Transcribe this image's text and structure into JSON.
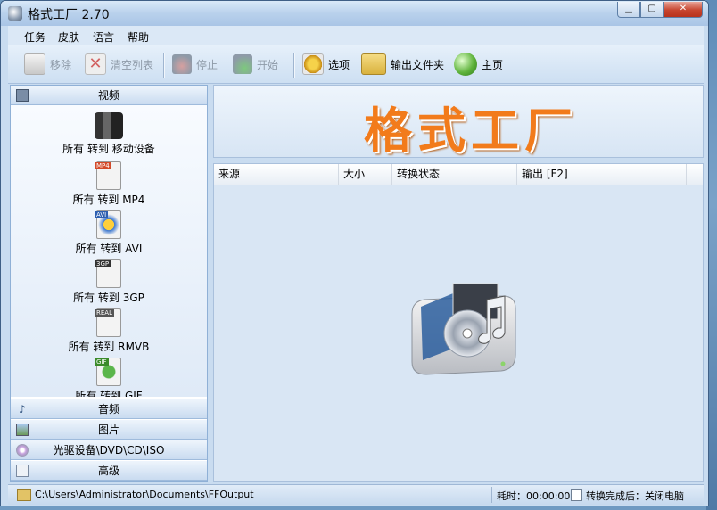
{
  "window": {
    "title": "格式工厂 2.70",
    "min": "▁",
    "max": "▢",
    "close": "✕"
  },
  "menu": [
    "任务",
    "皮肤",
    "语言",
    "帮助"
  ],
  "toolbar": {
    "remove": "移除",
    "clear_list": "清空列表",
    "stop": "停止",
    "start": "开始",
    "options": "选项",
    "output_folder": "输出文件夹",
    "home": "主页"
  },
  "sidebar": {
    "video": "视频",
    "video_items": [
      {
        "label": "所有 转到 移动设备",
        "icon": "mobile-device-icon",
        "badge": ""
      },
      {
        "label": "所有 转到 MP4",
        "icon": "mp4-file-icon",
        "badge": "MP4"
      },
      {
        "label": "所有 转到 AVI",
        "icon": "avi-file-icon",
        "badge": "AVI"
      },
      {
        "label": "所有 转到 3GP",
        "icon": "3gp-file-icon",
        "badge": "3GP"
      },
      {
        "label": "所有 转到 RMVB",
        "icon": "rmvb-file-icon",
        "badge": "REAL"
      },
      {
        "label": "所有 转到 GIF",
        "icon": "gif-file-icon",
        "badge": "GIF"
      }
    ],
    "audio": "音频",
    "image": "图片",
    "rom": "光驱设备\\DVD\\CD\\ISO",
    "advanced": "高级"
  },
  "banner": {
    "text": "格式工厂"
  },
  "table": {
    "headers": [
      "来源",
      "大小",
      "转换状态",
      "输出 [F2]"
    ]
  },
  "status": {
    "path": "C:\\Users\\Administrator\\Documents\\FFOutput",
    "elapsed": "耗时：00:00:00",
    "after_convert": "转换完成后：关闭电脑"
  },
  "colors": {
    "accent": "#f27b1b",
    "panel": "#c9dcf0"
  }
}
